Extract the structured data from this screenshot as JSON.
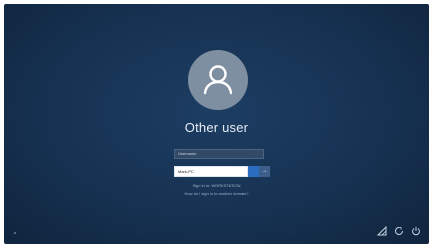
{
  "login": {
    "user_display_name": "Other user",
    "username_placeholder": "Username",
    "password_value": "Mark-PC",
    "submit_glyph": "→",
    "sign_in_to": "Sign in to: WORKSTATION",
    "link_text": "How do I sign in to another domain?"
  },
  "corner_icons": [
    "network-icon",
    "accessibility-icon",
    "power-icon"
  ],
  "colors": {
    "background": "#163252",
    "avatar": "#7f8fa2",
    "accent": "#2b6ec0"
  }
}
